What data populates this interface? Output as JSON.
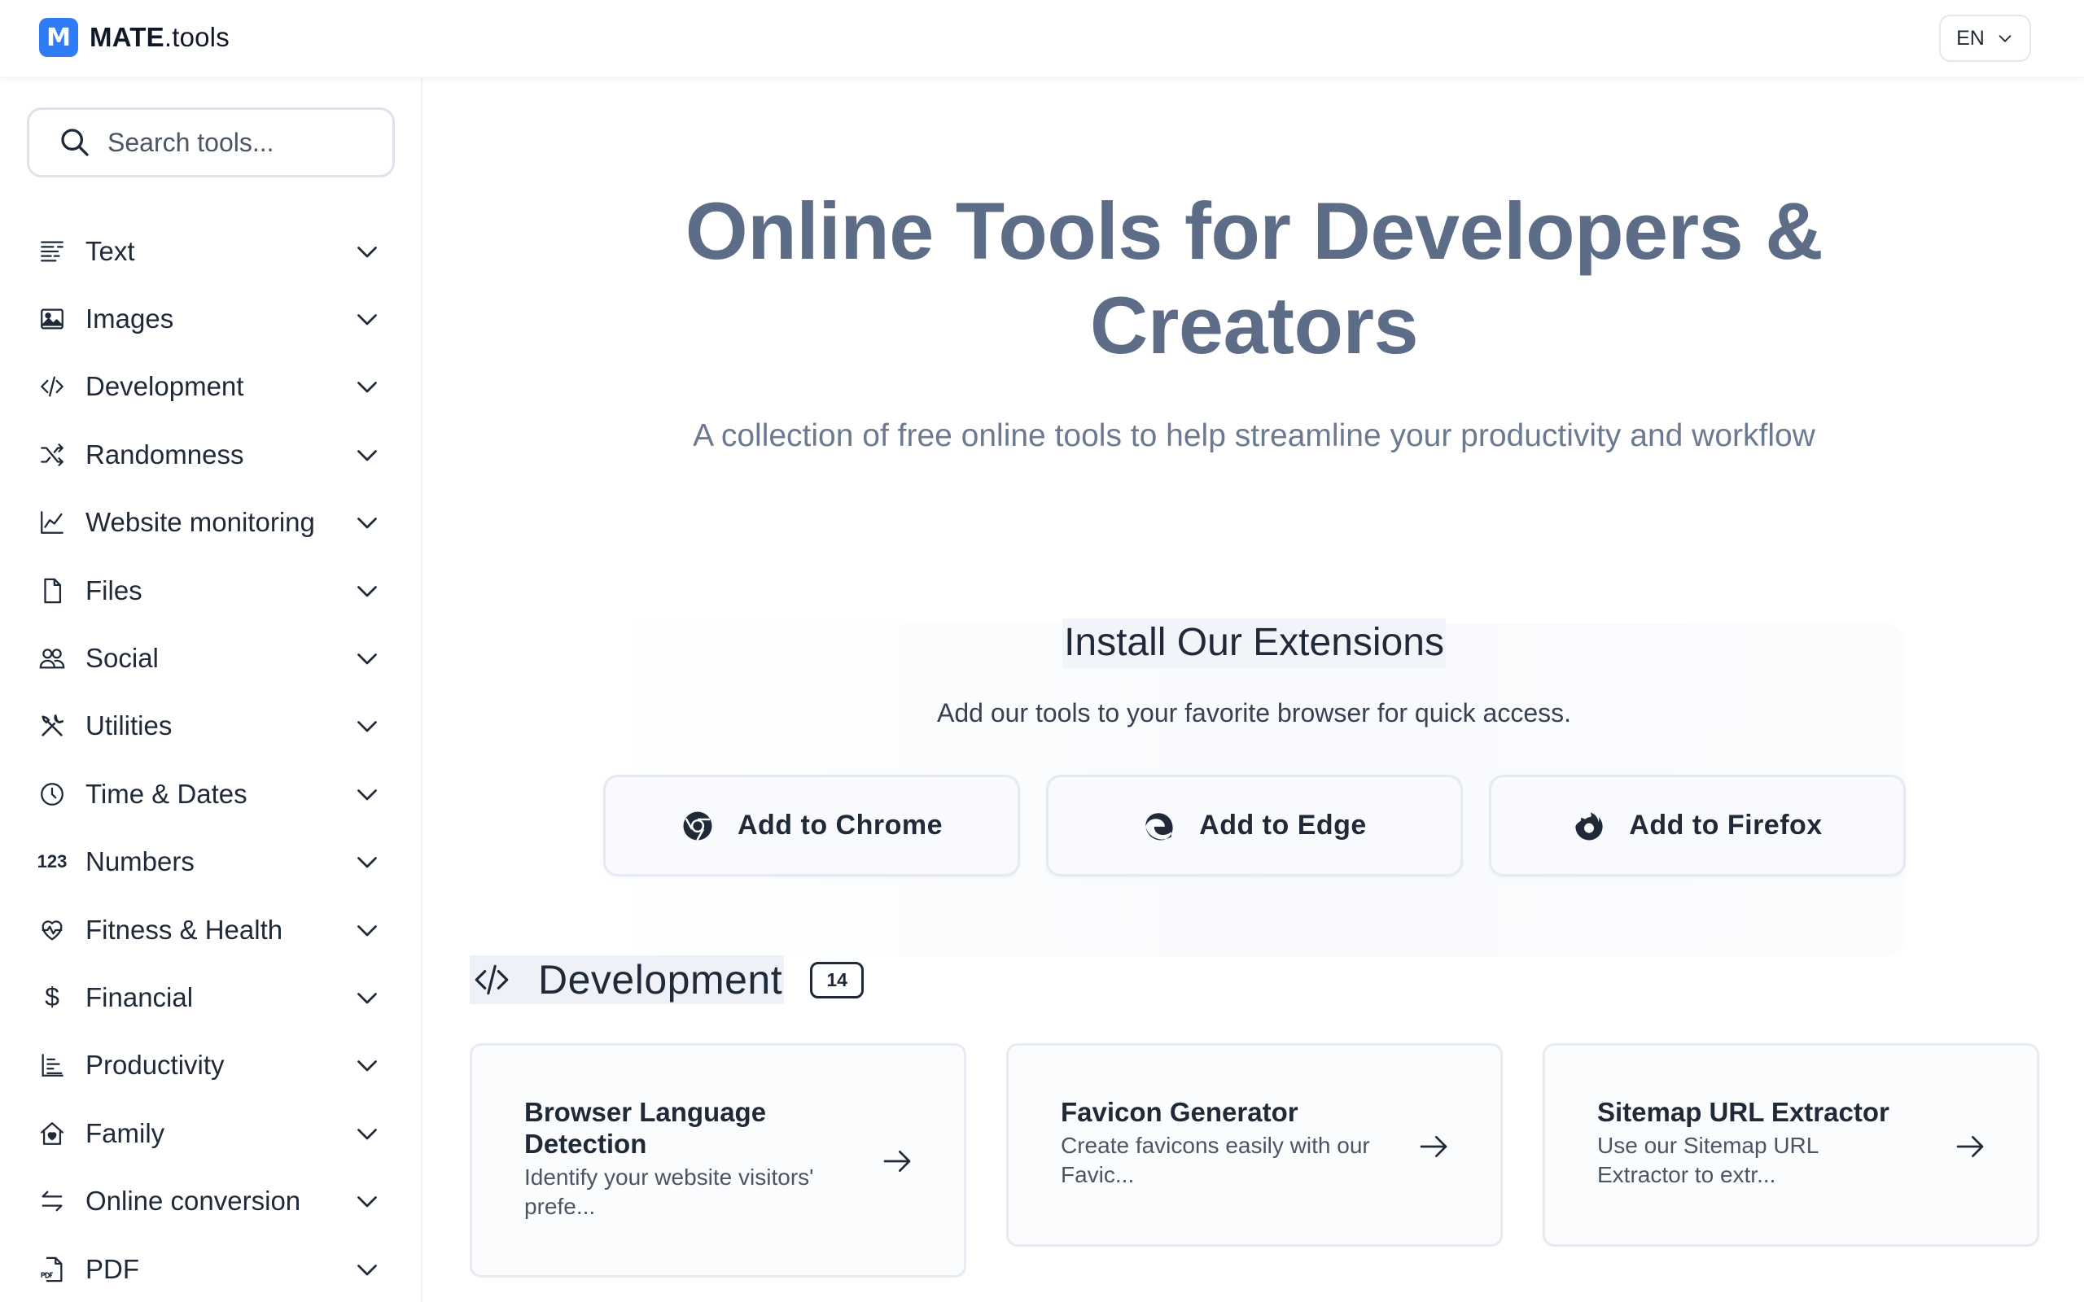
{
  "header": {
    "logo_letter": "M",
    "brand_bold": "MATE",
    "brand_light": ".tools",
    "language": "EN"
  },
  "sidebar": {
    "search_placeholder": "Search tools...",
    "items": [
      {
        "label": "Text",
        "icon": "text-align-icon"
      },
      {
        "label": "Images",
        "icon": "image-icon"
      },
      {
        "label": "Development",
        "icon": "code-icon"
      },
      {
        "label": "Randomness",
        "icon": "shuffle-icon"
      },
      {
        "label": "Website monitoring",
        "icon": "line-chart-icon"
      },
      {
        "label": "Files",
        "icon": "file-icon"
      },
      {
        "label": "Social",
        "icon": "users-icon"
      },
      {
        "label": "Utilities",
        "icon": "tools-icon"
      },
      {
        "label": "Time & Dates",
        "icon": "clock-icon"
      },
      {
        "label": "Numbers",
        "icon": "numbers-icon",
        "icon_text": "123"
      },
      {
        "label": "Fitness & Health",
        "icon": "heart-pulse-icon"
      },
      {
        "label": "Financial",
        "icon": "dollar-icon",
        "icon_text": "$"
      },
      {
        "label": "Productivity",
        "icon": "list-tree-icon"
      },
      {
        "label": "Family",
        "icon": "home-heart-icon"
      },
      {
        "label": "Online conversion",
        "icon": "arrows-swap-icon"
      },
      {
        "label": "PDF",
        "icon": "pdf-file-icon"
      }
    ]
  },
  "hero": {
    "title_line1": "Online Tools for Developers &",
    "title_line2": "Creators",
    "subtitle": "A collection of free online tools to help streamline your productivity and workflow"
  },
  "extensions": {
    "title": "Install Our Extensions",
    "subtitle": "Add our tools to your favorite browser for quick access.",
    "buttons": [
      {
        "label": "Add to Chrome",
        "icon": "chrome-icon"
      },
      {
        "label": "Add to Edge",
        "icon": "edge-icon"
      },
      {
        "label": "Add to Firefox",
        "icon": "firefox-icon"
      }
    ]
  },
  "section": {
    "title": "Development",
    "count": "14",
    "icon": "code-icon"
  },
  "cards": [
    {
      "title": "Browser Language Detection",
      "desc": "Identify your website visitors' prefe..."
    },
    {
      "title": "Favicon Generator",
      "desc": "Create favicons easily with our Favic..."
    },
    {
      "title": "Sitemap URL Extractor",
      "desc": "Use our Sitemap URL Extractor to extr..."
    }
  ],
  "colors": {
    "brand_blue": "#2f7cf6",
    "hero_title": "#5d6d87",
    "hero_subtitle": "#6b7a90"
  }
}
